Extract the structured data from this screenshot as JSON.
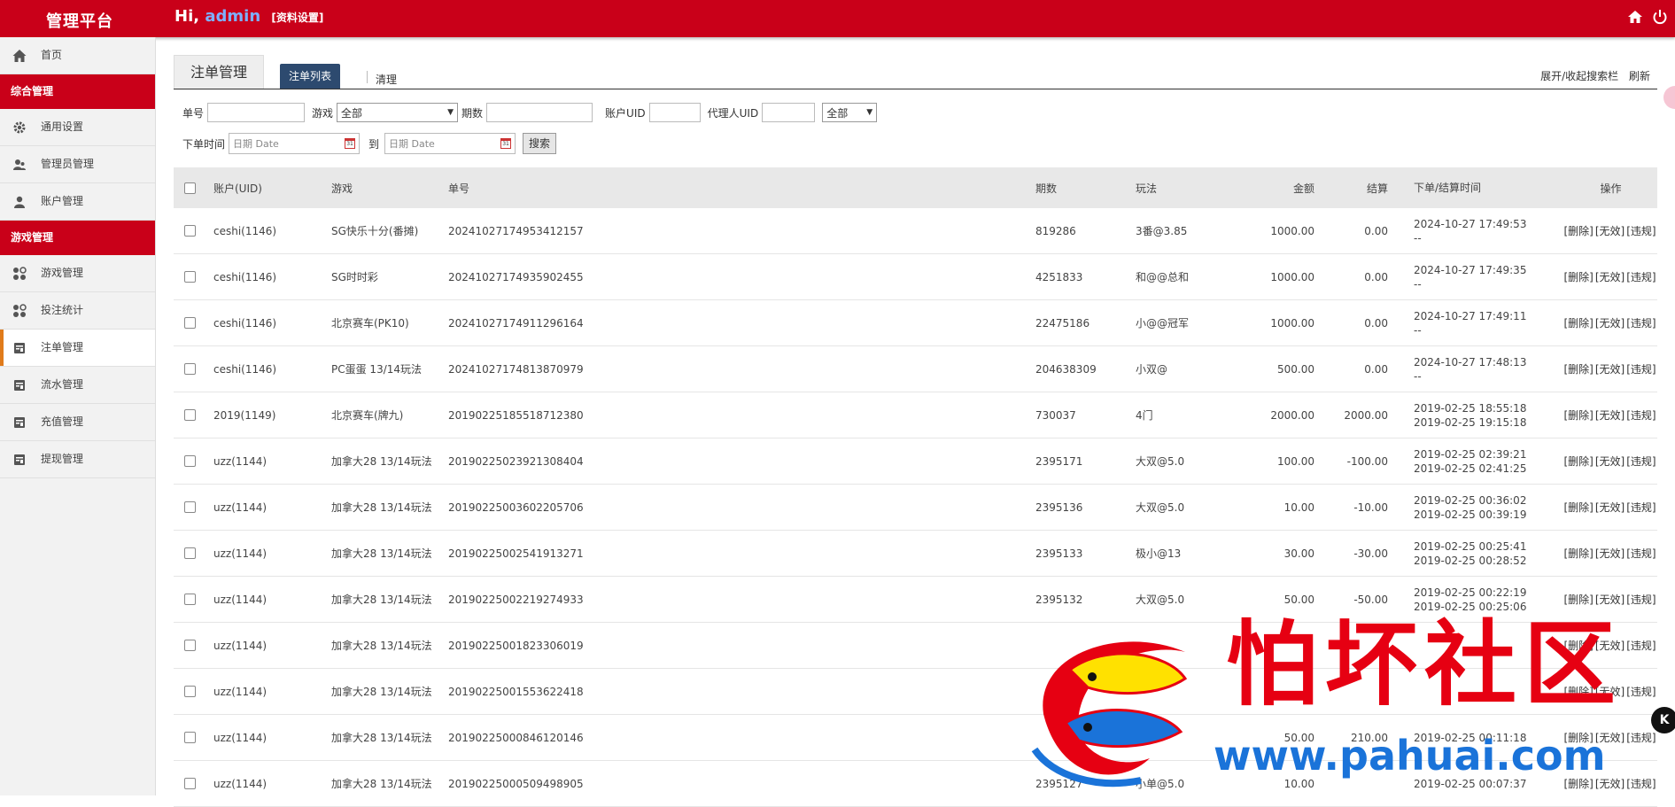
{
  "topbar": {
    "brand": "管理平台",
    "hi": "Hi,",
    "username": "admin",
    "settings_link": "[资料设置]",
    "icons": [
      "home-icon",
      "power-icon"
    ]
  },
  "sidebar": {
    "home": {
      "label": "首页",
      "icon": "home-icon"
    },
    "sections": [
      {
        "title": "综合管理",
        "items": [
          {
            "label": "通用设置",
            "icon": "gear-icon"
          },
          {
            "label": "管理员管理",
            "icon": "users-icon"
          },
          {
            "label": "账户管理",
            "icon": "user-icon"
          }
        ]
      },
      {
        "title": "游戏管理",
        "items": [
          {
            "label": "游戏管理",
            "icon": "grid-icon"
          },
          {
            "label": "投注统计",
            "icon": "grid-icon"
          },
          {
            "label": "注单管理",
            "icon": "doc-icon",
            "active": true
          },
          {
            "label": "流水管理",
            "icon": "doc-icon"
          },
          {
            "label": "充值管理",
            "icon": "doc-icon"
          },
          {
            "label": "提现管理",
            "icon": "doc-icon"
          }
        ]
      }
    ]
  },
  "tabs": {
    "page_tab": "注单管理",
    "active_subtab": "注单列表",
    "subtab": "清理",
    "right_links": [
      "展开/收起搜索栏",
      "刷新"
    ]
  },
  "filters": {
    "order_label": "单号",
    "game_label": "游戏",
    "game_value": "全部",
    "issue_label": "期数",
    "uid_label": "账户UID",
    "agent_label": "代理人UID",
    "agent_select": "全部",
    "time_label": "下单时间",
    "date_placeholder_from": "日期 Date",
    "to_label": "到",
    "date_placeholder_to": "日期 Date",
    "search_button": "搜索"
  },
  "table": {
    "headers": {
      "account": "账户(UID)",
      "game": "游戏",
      "order": "单号",
      "issue": "期数",
      "play": "玩法",
      "amount": "金额",
      "settle": "结算",
      "time": "下单/结算时间",
      "ops": "操作"
    },
    "ops_labels": [
      "[删除]",
      "[无效]",
      "[违规]"
    ],
    "rows": [
      {
        "account": "ceshi(1146)",
        "game": "SG快乐十分(番摊)",
        "order": "20241027174953412157",
        "issue": "819286",
        "play": "3番@3.85",
        "amount": "1000.00",
        "settle": "0.00",
        "time1": "2024-10-27 17:49:53",
        "time2": "--"
      },
      {
        "account": "ceshi(1146)",
        "game": "SG时时彩",
        "order": "20241027174935902455",
        "issue": "4251833",
        "play": "和@@总和",
        "amount": "1000.00",
        "settle": "0.00",
        "time1": "2024-10-27 17:49:35",
        "time2": "--"
      },
      {
        "account": "ceshi(1146)",
        "game": "北京赛车(PK10)",
        "order": "20241027174911296164",
        "issue": "22475186",
        "play": "小@@冠军",
        "amount": "1000.00",
        "settle": "0.00",
        "time1": "2024-10-27 17:49:11",
        "time2": "--"
      },
      {
        "account": "ceshi(1146)",
        "game": "PC蛋蛋 13/14玩法",
        "order": "20241027174813870979",
        "issue": "204638309",
        "play": "小双@",
        "amount": "500.00",
        "settle": "0.00",
        "time1": "2024-10-27 17:48:13",
        "time2": "--"
      },
      {
        "account": "2019(1149)",
        "game": "北京赛车(牌九)",
        "order": "20190225185518712380",
        "issue": "730037",
        "play": "4门",
        "amount": "2000.00",
        "settle": "2000.00",
        "time1": "2019-02-25 18:55:18",
        "time2": "2019-02-25 19:15:18"
      },
      {
        "account": "uzz(1144)",
        "game": "加拿大28 13/14玩法",
        "order": "20190225023921308404",
        "issue": "2395171",
        "play": "大双@5.0",
        "amount": "100.00",
        "settle": "-100.00",
        "time1": "2019-02-25 02:39:21",
        "time2": "2019-02-25 02:41:25"
      },
      {
        "account": "uzz(1144)",
        "game": "加拿大28 13/14玩法",
        "order": "20190225003602205706",
        "issue": "2395136",
        "play": "大双@5.0",
        "amount": "10.00",
        "settle": "-10.00",
        "time1": "2019-02-25 00:36:02",
        "time2": "2019-02-25 00:39:19"
      },
      {
        "account": "uzz(1144)",
        "game": "加拿大28 13/14玩法",
        "order": "20190225002541913271",
        "issue": "2395133",
        "play": "极小@13",
        "amount": "30.00",
        "settle": "-30.00",
        "time1": "2019-02-25 00:25:41",
        "time2": "2019-02-25 00:28:52"
      },
      {
        "account": "uzz(1144)",
        "game": "加拿大28 13/14玩法",
        "order": "20190225002219274933",
        "issue": "2395132",
        "play": "大双@5.0",
        "amount": "50.00",
        "settle": "-50.00",
        "time1": "2019-02-25 00:22:19",
        "time2": "2019-02-25 00:25:06"
      },
      {
        "account": "uzz(1144)",
        "game": "加拿大28 13/14玩法",
        "order": "20190225001823306019",
        "issue": "",
        "play": "",
        "amount": "",
        "settle": "",
        "time1": "",
        "time2": ""
      },
      {
        "account": "uzz(1144)",
        "game": "加拿大28 13/14玩法",
        "order": "20190225001553622418",
        "issue": "",
        "play": "",
        "amount": "",
        "settle": "",
        "time1": "",
        "time2": ""
      },
      {
        "account": "uzz(1144)",
        "game": "加拿大28 13/14玩法",
        "order": "20190225000846120146",
        "issue": "",
        "play": "",
        "amount": "50.00",
        "settle": "210.00",
        "time1": "",
        "time2": "2019-02-25 00:11:18"
      },
      {
        "account": "uzz(1144)",
        "game": "加拿大28 13/14玩法",
        "order": "20190225000509498905",
        "issue": "2395127",
        "play": "小单@5.0",
        "amount": "10.00",
        "settle": "",
        "time1": "",
        "time2": "2019-02-25 00:07:37"
      }
    ]
  },
  "watermark": {
    "title": "怕坏社区",
    "url": "www.pahuai.com"
  },
  "badge": "K"
}
